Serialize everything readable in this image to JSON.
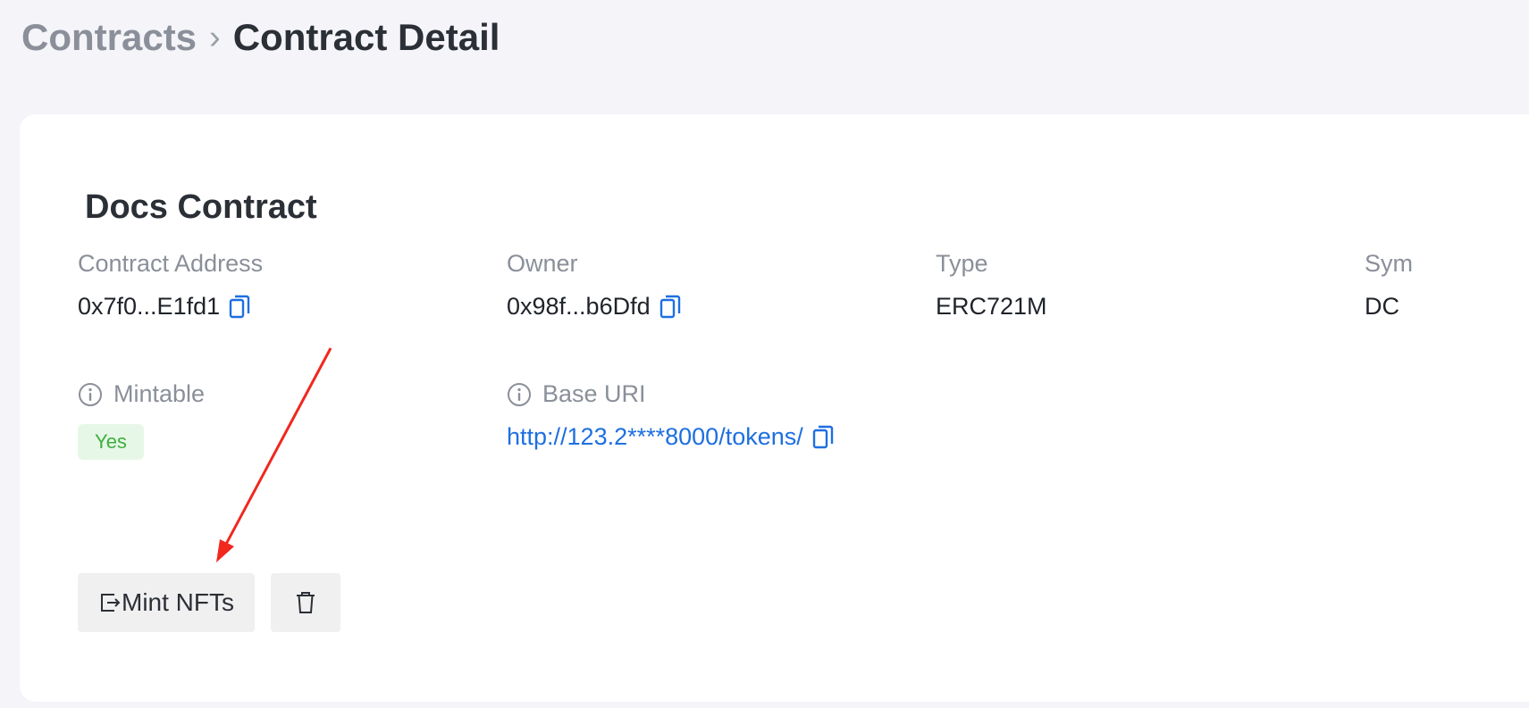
{
  "breadcrumb": {
    "parent": "Contracts",
    "separator": "›",
    "current": "Contract Detail"
  },
  "contract": {
    "name": "Docs Contract",
    "fields": {
      "address": {
        "label": "Contract Address",
        "value": "0x7f0...E1fd1"
      },
      "owner": {
        "label": "Owner",
        "value": "0x98f...b6Dfd"
      },
      "type": {
        "label": "Type",
        "value": "ERC721M"
      },
      "symbol": {
        "label": "Sym",
        "value": "DC"
      }
    },
    "mintable": {
      "label": "Mintable",
      "value": "Yes"
    },
    "base_uri": {
      "label": "Base URI",
      "value": "http://123.2****8000/tokens/"
    }
  },
  "actions": {
    "mint_label": "Mint NFTs"
  },
  "colors": {
    "accent_link": "#1e6fe0",
    "success_bg": "#e7f7e7",
    "success_text": "#3fae3f",
    "annotation_arrow": "#f0281e"
  },
  "icons": {
    "copy": "copy-icon",
    "info": "info-icon",
    "mint": "export-icon",
    "delete": "trash-icon"
  }
}
